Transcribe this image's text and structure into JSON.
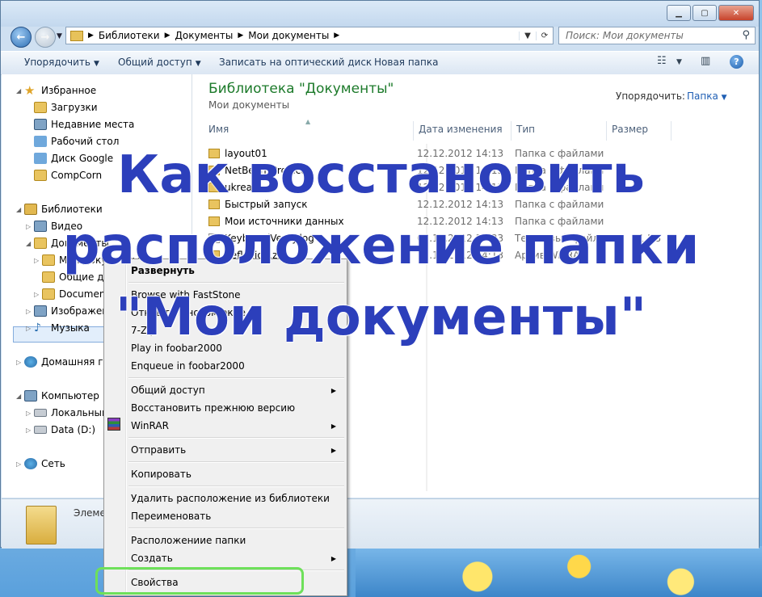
{
  "window": {
    "address": [
      "Библиотеки",
      "Документы",
      "Мои документы"
    ],
    "search_placeholder": "Поиск: Мои документы"
  },
  "toolbar": {
    "organize": "Упорядочить",
    "share": "Общий доступ",
    "burn": "Записать на оптический диск",
    "new_folder": "Новая папка"
  },
  "nav": {
    "favorites": "Избранное",
    "downloads": "Загрузки",
    "recent": "Недавние места",
    "desktop": "Рабочий стол",
    "google_drive": "Диск Google",
    "compcorn": "CompCorn",
    "libraries": "Библиотеки",
    "video": "Видео",
    "documents": "Документы",
    "my_docs": "Мои документы",
    "public_docs": "Общие документы",
    "documents_folder": "Documents",
    "images": "Изображения",
    "music": "Музыка",
    "homegroup": "Домашняя группа",
    "computer": "Компьютер",
    "local_disk": "Локальный диск (C:)",
    "data_disk": "Data (D:)",
    "network": "Сеть"
  },
  "content": {
    "title": "Библиотека \"Документы\"",
    "subtitle": "Мои документы",
    "arrange_label": "Упорядочить:",
    "arrange_value": "Папка",
    "columns": [
      "Имя",
      "Дата изменения",
      "Тип",
      "Размер"
    ],
    "rows": [
      {
        "name": "layout01",
        "date": "12.12.2012 14:13",
        "type": "Папка с файлами",
        "size": ""
      },
      {
        "name": "NetBeansProjects",
        "date": "12.12.2012 14:13",
        "type": "Папка с файлами",
        "size": ""
      },
      {
        "name": "ukrea",
        "date": "12.12.2012 14:13",
        "type": "Папка с файлами",
        "size": ""
      },
      {
        "name": "Быстрый запуск",
        "date": "12.12.2012 14:13",
        "type": "Папка с файлами",
        "size": ""
      },
      {
        "name": "Мои источники данных",
        "date": "12.12.2012 14:13",
        "type": "Папка с файлами",
        "size": ""
      },
      {
        "name": "KeyboardVerify.log",
        "date": "03.12.2012 13:33",
        "type": "Текстовый файл",
        "size": "1 КБ"
      },
      {
        "name": "Reflexion.zip",
        "date": "12.12.2012 14:13",
        "type": "Архив WinRAR",
        "size": ""
      }
    ]
  },
  "details": {
    "text": "Элементов"
  },
  "context_menu": {
    "expand": "Развернуть",
    "faststone": "Browse with FastStone",
    "new_window": "Открыть в новом окне",
    "sevenzip": "7-Zip",
    "play_foobar": "Play in foobar2000",
    "enqueue_foobar": "Enqueue in foobar2000",
    "share": "Общий доступ",
    "restore": "Восстановить прежнюю версию",
    "winrar": "WinRAR",
    "send": "Отправить",
    "copy": "Копировать",
    "remove_location": "Удалить расположение из библиотеки",
    "rename": "Переименовать",
    "open_location": "Расположениие папки",
    "create": "Создать",
    "properties": "Свойства"
  },
  "overlay": {
    "line1": "Как восстановить",
    "line2": "расположение папки",
    "line3": "\"Мои документы\""
  },
  "colors": {
    "overlay_text": "#2c3fbb",
    "highlight": "#6ee05a",
    "library_title": "#1c7a2a"
  }
}
